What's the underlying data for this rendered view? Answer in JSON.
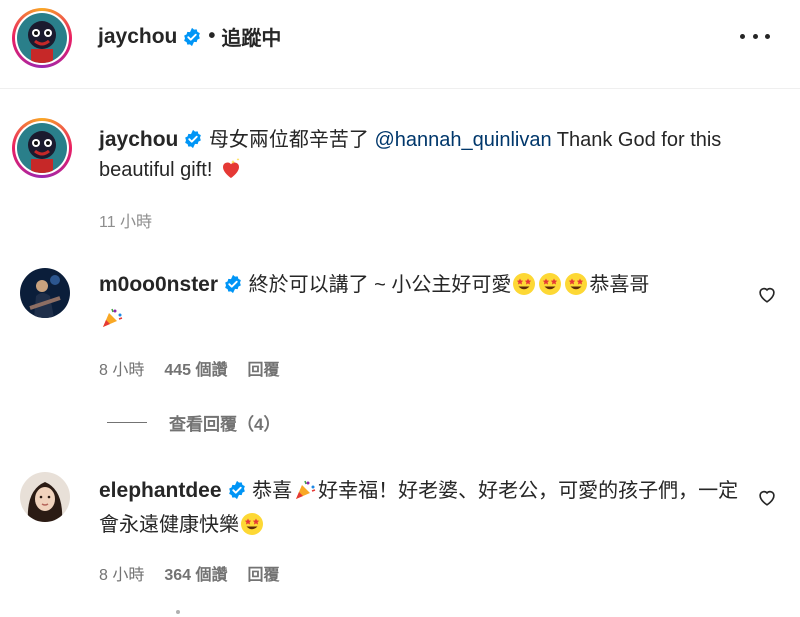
{
  "post": {
    "author": "jaychou",
    "follow_status": "追蹤中",
    "separator": "•"
  },
  "caption": {
    "author": "jaychou",
    "text_before": " 母女兩位都辛苦了 ",
    "mention": "@hannah_quinlivan",
    "text_after": " Thank God for this beautiful gift! ",
    "time": "11 小時"
  },
  "comments": [
    {
      "author": "m0oo0nster",
      "text": " 終於可以講了 ~ 小公主好可愛",
      "text_end": "恭喜哥",
      "time": "8 小時",
      "likes": "445 個讚",
      "reply": "回覆"
    },
    {
      "author": "elephantdee",
      "text_start": " 恭喜",
      "text_mid": "好幸福！好老婆、好老公，可愛的孩子們，一定會永遠健康快樂",
      "time": "8 小時",
      "likes": "364 個讚",
      "reply": "回覆"
    }
  ],
  "view_replies": "查看回覆（4）",
  "colors": {
    "mention": "#00376b",
    "verified": "#0095f6",
    "muted": "#737373",
    "heart_emoji": "#e53935"
  },
  "icons": [
    "verified-badge-icon",
    "more-options-icon",
    "heart-outline-icon",
    "sparkling-heart-emoji",
    "star-struck-emoji",
    "party-popper-emoji"
  ]
}
